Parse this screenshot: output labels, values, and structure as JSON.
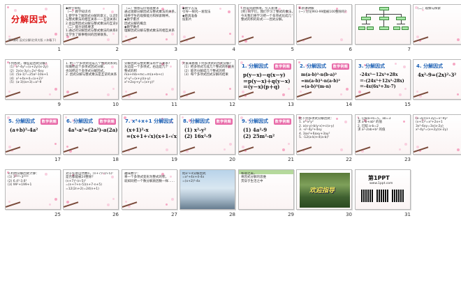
{
  "slides": [
    {
      "num": "1",
      "title": "分解因式",
      "subtitle": "第1课时 因式分解(北师大版 八年级下)"
    },
    {
      "num": "2",
      "lines": "◆教学目标\n（一）教学知识点\n1.使学生了解因式分解的意义，认识因式分解\n与整式乘法的相互关系——互逆关系(即相反变形)\n2.会运用因式分解与整式乘法的互逆关系，\n（二）能力训练要求\n1.通过对分解因式与整式乘法的关系的分析，\n让学生了解事物间的因果联系。"
    },
    {
      "num": "3",
      "lines": "（三）情感与价值观要求\n通过观察分解因式与整式乘法的关系，\n培养学生的观察能力和探索精神。\n◆教学重点\n因式分解的概念\n◆教学难点\n理解因式分解与整式乘法的相互关系"
    },
    {
      "num": "4",
      "lines": "◆教学方法\n引导—探究—发现法\n◆教具准备\n投影片"
    },
    {
      "num": "5",
      "lines": "I.创设问题情境，引入新课\n[师] 同学们，我们学习了整式的乘法，\n今天我们将学习把一个多项式化成几个\n整式的积的形式——因式分解。"
    },
    {
      "num": "6",
      "lines": "Ⅱ.新课讲解\n(一) 讨论993-99能被100整除吗？"
    },
    {
      "num": "7",
      "tree": true
    },
    {
      "num": "8",
      "lines": "（二）观察与探索"
    },
    {
      "num": "9",
      "lines": "下列各式，哪些是因式分解？\n（1）x²-4y²=(x+2y)(x-2y)\n（2）2x(x-3y)=2x²-6xy\n（3）(5a-1)²=25a²-10a+1\n（4）x²+4x+4=(x+2)²\n（5）(a-3)(a+3)=a²-9"
    },
    {
      "num": "10",
      "lines": "1. 把一个多项式化成几个整式的积的形式，\n叫做把这个多项式因式分解，\n也叫把这个多项式分解因式。\n2. 因式分解与整式乘法是互逆的关系"
    },
    {
      "num": "11",
      "lines": "分解因式与整式乘法有什么关系？\n左边是一个多项式，右边是几个\n整式的积\nma+mb+mc=m(a+b+c)\nx²-y²=(x+y)(x-y)\nx²+2xy+y²=(x+y)²"
    },
    {
      "num": "12",
      "lines": "大家来看看下列多项式的因式分解？\n（1）把多项式写成几个整式的积的形式\n（2）能否分解成几个整式的积\n（3）每个多项式因式分解的结果"
    },
    {
      "num": "13",
      "heading": "1. 分解因式",
      "badge": "数学例题",
      "math": "p(y－x)－q(x－y)\n＝p(y－x)＋q(y－x)\n＝(y－x)(p＋q)"
    },
    {
      "num": "14",
      "heading": "2. 分解因式",
      "badge": "数学例题",
      "math": "m(a-b)²-n(b-a)²\n=m(a-b)²-n(a-b)²\n=(a-b)²(m-n)"
    },
    {
      "num": "15",
      "heading": "3. 分解因式",
      "math": "-24x³－12x²+28x\n＝-(24x³＋12x²-28x)\n＝-4x(6x²+3x-7)"
    },
    {
      "num": "16",
      "heading": "4. 分解因式",
      "math": "4x²-9=(2x)²-3²"
    },
    {
      "num": "17",
      "heading": "5. 分解因式",
      "badge": "数学例题",
      "math": "(a+b)²-4a²"
    },
    {
      "num": "18",
      "heading": "6. 分解因式",
      "badge": "数学例题",
      "math": "4a³-a²=(2a²)-a(2a)(2a²-a)"
    },
    {
      "num": "19",
      "heading": "7. x²+x+1 分解因式",
      "math": "(x+1)²-x\n=(x+1+√x)(x+1-√x)"
    },
    {
      "num": "20",
      "heading": "8. 分解因式",
      "badge": "数学例题",
      "math": "(1) x²-y²\n(2) 16x²-9"
    },
    {
      "num": "21",
      "heading": "9. 分解因式",
      "badge": "数学例题",
      "math": "(1) 4a²-9\n(2) 25m²-n²"
    },
    {
      "num": "22",
      "lines": "把下列多项式分解因式：\n1. x²-x²y²\n2. a(x-y)-b(y-x)+c(x-y)\n3. -x²-4y²+4xy\n4. 3ax²+6axy+3ay²\n5. -12(a-b)+4(a-b)²"
    },
    {
      "num": "23",
      "lines": "1. 已知a+b=5，ab=3\n求 a²b+ab² 的值\n2. 已知 a-b=2\n求 a²-2ab+b² 的值"
    },
    {
      "num": "24",
      "lines": "(x-3y)(x+3y)=x²-9y²\n(x+1)²=x²+2x+1\n3x²-6xy=3x(x-2y)\nx²-4y²=(x+2y)(x-2y)"
    },
    {
      "num": "25",
      "lines": "3.利用分解因式计算：\n(1) 3²⁰⁰¹-3²⁰⁰⁰\n(2) 6.4²-3.6²\n(3) 99²+199+1"
    },
    {
      "num": "26",
      "lines": "对于任意自然数n，(n+7)²-(n-5)²\n是否都能被24整除？\n(n+7)²-(n-5)²\n=(n+7+n-5)(n+7-n+5)\n=12(2n+2)=24(n+1)"
    },
    {
      "num": "27",
      "lines": "趣味数学：\n将一个多项式变形为整式的积，\n就如同把一个数分解质因数一样……"
    },
    {
      "num": "28",
      "lines": "把x²+4分解因式\n=x²+4x+4-4x\n=(x+2)²-4x"
    },
    {
      "num": "29",
      "lines": "和谐之美，\n将因式分解的思维\n贯穿于生活之中"
    },
    {
      "num": "30",
      "welcome": "欢迎指导"
    },
    {
      "num": "31",
      "logo_main": "第1PPT",
      "logo_sub": "www.1ppt.com"
    }
  ]
}
